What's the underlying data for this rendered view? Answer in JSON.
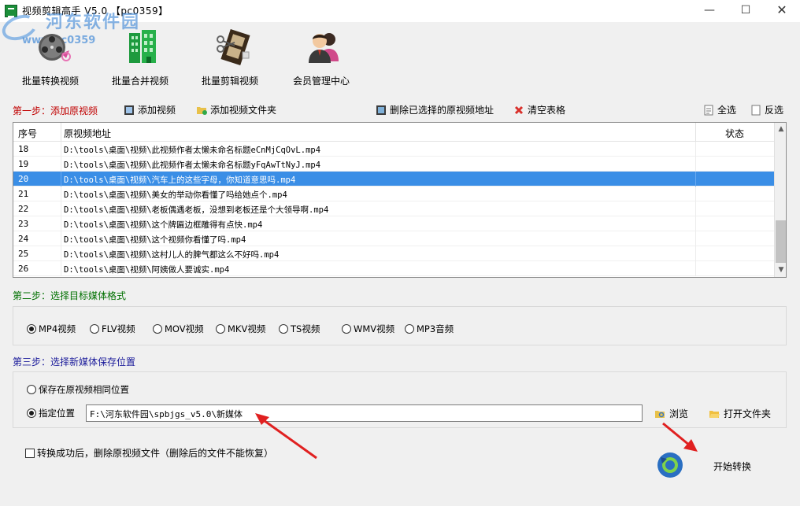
{
  "window": {
    "title": "视频剪辑高手 V5.0 【pc0359】",
    "controls": {
      "minimize": "—",
      "maximize": "☐",
      "close": "✕"
    }
  },
  "watermark": {
    "line1": "河东软件园",
    "line2": "www.pc0359"
  },
  "toolbar": [
    {
      "label": "批量转换视频",
      "icon": "film-reel-icon"
    },
    {
      "label": "批量合并视频",
      "icon": "building-merge-icon"
    },
    {
      "label": "批量剪辑视频",
      "icon": "film-scissors-icon"
    },
    {
      "label": "会员管理中心",
      "icon": "members-icon"
    }
  ],
  "step1": {
    "title": "第一步：添加原视频",
    "add_video": "添加视频",
    "add_folder": "添加视频文件夹",
    "delete_selected": "删除已选择的原视频地址",
    "clear_table": "清空表格",
    "select_all": "全选",
    "invert": "反选"
  },
  "table": {
    "columns": {
      "index": "序号",
      "path": "原视频地址",
      "status": "状态"
    },
    "rows": [
      {
        "index": "18",
        "path": "D:\\tools\\桌面\\视频\\此视频作者太懒未命名标题eCnMjCqOvL.mp4",
        "status": ""
      },
      {
        "index": "19",
        "path": "D:\\tools\\桌面\\视频\\此视频作者太懒未命名标题yFqAwTtNyJ.mp4",
        "status": ""
      },
      {
        "index": "20",
        "path": "D:\\tools\\桌面\\视频\\汽车上的这些字母，你知道意思吗.mp4",
        "status": ""
      },
      {
        "index": "21",
        "path": "D:\\tools\\桌面\\视频\\美女的举动你看懂了吗给她点个.mp4",
        "status": ""
      },
      {
        "index": "22",
        "path": "D:\\tools\\桌面\\视频\\老板偶遇老板，没想到老板还是个大领导啊.mp4",
        "status": ""
      },
      {
        "index": "23",
        "path": "D:\\tools\\桌面\\视频\\这个牌匾边框雕得有点快.mp4",
        "status": ""
      },
      {
        "index": "24",
        "path": "D:\\tools\\桌面\\视频\\这个视频你看懂了吗.mp4",
        "status": ""
      },
      {
        "index": "25",
        "path": "D:\\tools\\桌面\\视频\\这村儿人的脾气都这么不好吗.mp4",
        "status": ""
      },
      {
        "index": "26",
        "path": "D:\\tools\\桌面\\视频\\阿姨做人要诚实.mp4",
        "status": ""
      }
    ],
    "selected_index": "20"
  },
  "step2": {
    "title": "第二步：选择目标媒体格式",
    "formats": [
      {
        "label": "MP4视频",
        "checked": true
      },
      {
        "label": "FLV视频",
        "checked": false
      },
      {
        "label": "MOV视频",
        "checked": false
      },
      {
        "label": "MKV视频",
        "checked": false
      },
      {
        "label": "TS视频",
        "checked": false
      },
      {
        "label": "WMV视频",
        "checked": false
      },
      {
        "label": "MP3音频",
        "checked": false
      }
    ]
  },
  "step3": {
    "title": "第三步：选择新媒体保存位置",
    "same_location": "保存在原视频相同位置",
    "specify_location": "指定位置",
    "path_value": "F:\\河东软件园\\spbjgs_v5.0\\新媒体",
    "browse": "浏览",
    "open_folder": "打开文件夹"
  },
  "footer": {
    "delete_after": "转换成功后，删除原视频文件（删除后的文件不能恢复）",
    "start": "开始转换"
  },
  "colors": {
    "selection": "#3a8ee6",
    "step1": "#c00000",
    "step2": "#007000",
    "step3": "#1a1a9a",
    "annotation": "#e02020"
  }
}
